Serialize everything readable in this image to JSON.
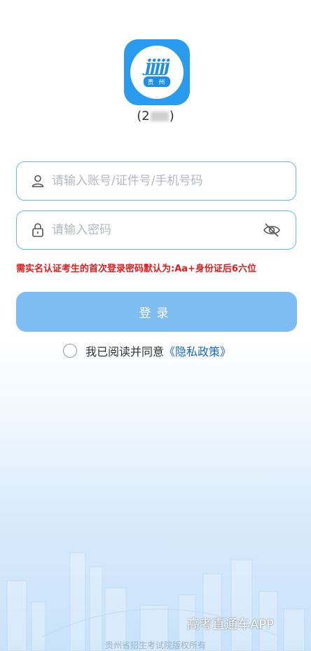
{
  "app": {
    "logo_text": "jjjjj",
    "logo_sub": "贵 州",
    "version_prefix": "(2",
    "version_suffix": ")"
  },
  "form": {
    "account_placeholder": "请输入账号/证件号/手机号码",
    "password_placeholder": "请输入密码",
    "notice": "需实名认证考生的首次登录密码默认为:Aa+身份证后6六位",
    "login_label": "登录",
    "agree_text": "我已阅读并同意",
    "policy_link": "《隐私政策》"
  },
  "footer": {
    "watermark": "高考直通车APP",
    "copyright": "贵州省招生考试院版权所有"
  },
  "colors": {
    "accent": "#2a9cf0",
    "button": "#7ebdf4",
    "notice": "#e21b1b",
    "link": "#1a67c4"
  }
}
